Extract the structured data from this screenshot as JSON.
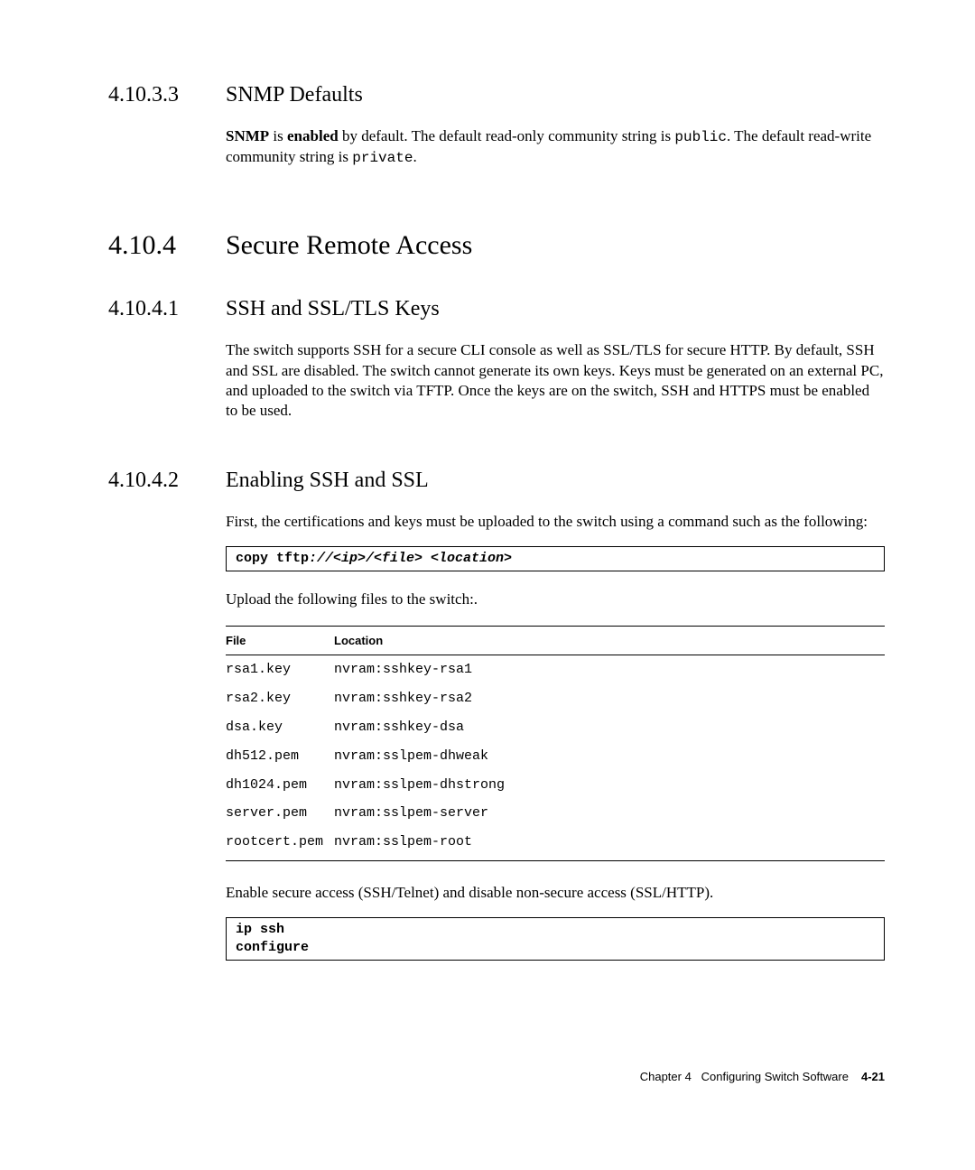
{
  "s1": {
    "num": "4.10.3.3",
    "title": "SNMP Defaults",
    "p_bold1": "SNMP",
    "p_t1": " is ",
    "p_bold2": "enabled",
    "p_t2": " by default. The default read-only community string is ",
    "p_mono1": "public",
    "p_t3": ". The default read-write community string is ",
    "p_mono2": "private",
    "p_t4": "."
  },
  "s2": {
    "num": "4.10.4",
    "title": "Secure Remote Access"
  },
  "s3": {
    "num": "4.10.4.1",
    "title": "SSH and SSL/TLS Keys",
    "p": "The switch supports SSH for a secure CLI console as well as SSL/TLS for secure HTTP. By default, SSH and SSL are disabled. The switch cannot generate its own keys.  Keys must be generated on an external PC, and uploaded to the switch via TFTP. Once the keys are on the switch, SSH and HTTPS must be enabled to be used."
  },
  "s4": {
    "num": "4.10.4.2",
    "title": "Enabling SSH and SSL",
    "p1": "First, the certifications and keys must be uploaded to the switch using a command such as the following:",
    "cmd1a": "copy tftp",
    "cmd1b": "://<ip>/<file> <location>",
    "p2": "Upload the following files to the switch:.",
    "th1": "File",
    "th2": "Location",
    "rows": [
      {
        "f": "rsa1.key",
        "l": "nvram:sshkey-rsa1"
      },
      {
        "f": "rsa2.key",
        "l": "nvram:sshkey-rsa2"
      },
      {
        "f": "dsa.key",
        "l": "nvram:sshkey-dsa"
      },
      {
        "f": "dh512.pem",
        "l": "nvram:sslpem-dhweak"
      },
      {
        "f": "dh1024.pem",
        "l": "nvram:sslpem-dhstrong"
      },
      {
        "f": "server.pem",
        "l": "nvram:sslpem-server"
      },
      {
        "f": "rootcert.pem",
        "l": "nvram:sslpem-root"
      }
    ],
    "p3": "Enable secure access (SSH/Telnet) and disable non-secure access (SSL/HTTP).",
    "cmd2a": "ip ssh",
    "cmd2b": "configure"
  },
  "footer": {
    "chapter": "Chapter 4",
    "title": "Configuring Switch Software",
    "page": "4-21"
  }
}
